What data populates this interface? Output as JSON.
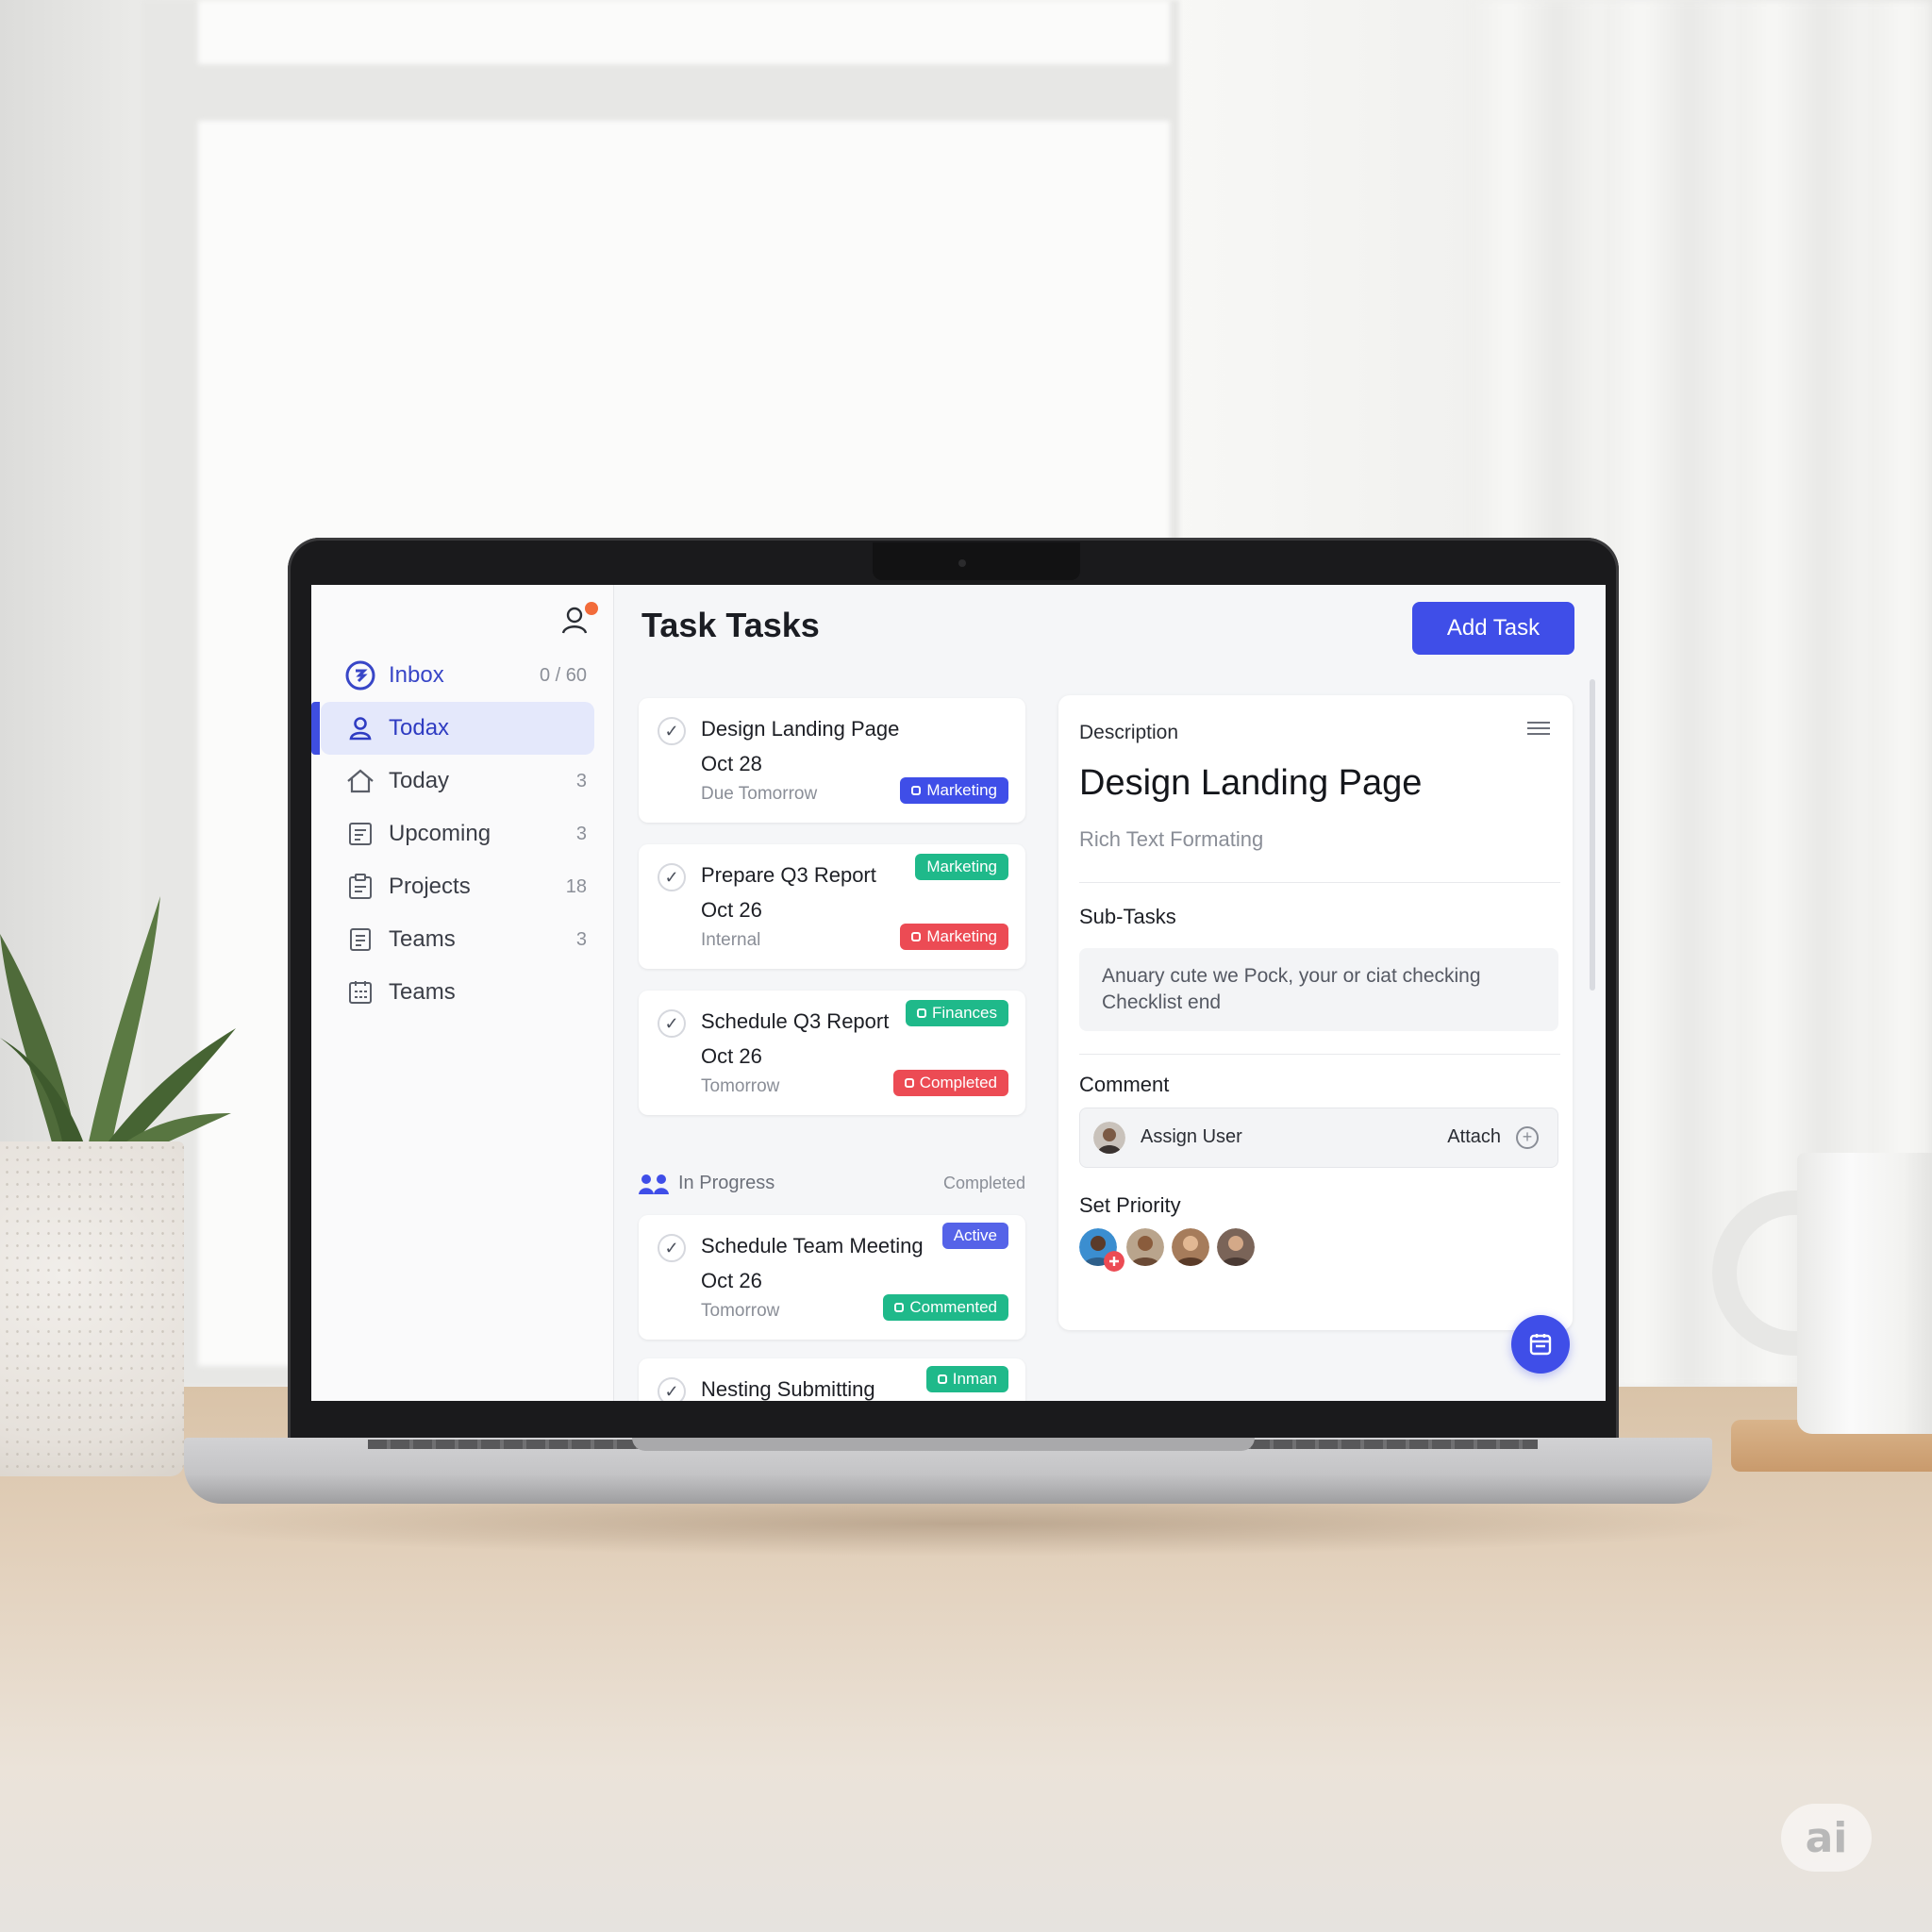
{
  "window": {
    "app_title": "Task Tasks",
    "add_task_label": "Add Task"
  },
  "sidebar": {
    "items": [
      {
        "label": "Inbox",
        "count": "0 / 60",
        "icon": "inbox-circle-icon",
        "state": "highlight"
      },
      {
        "label": "Todax",
        "count": "",
        "icon": "user-icon",
        "state": "active"
      },
      {
        "label": "Today",
        "count": "3",
        "icon": "home-icon"
      },
      {
        "label": "Upcoming",
        "count": "3",
        "icon": "calendar-note-icon"
      },
      {
        "label": "Projects",
        "count": "18",
        "icon": "clipboard-icon"
      },
      {
        "label": "Teams",
        "count": "3",
        "icon": "document-icon"
      },
      {
        "label": "Teams",
        "count": "",
        "icon": "team-grid-icon"
      }
    ]
  },
  "tasks": [
    {
      "title": "Design Landing Page",
      "date": "Oct 28",
      "subtitle": "Due Tomorrow",
      "tags": [
        {
          "label": "Marketing",
          "color": "#3f4ee8"
        }
      ]
    },
    {
      "title": "Prepare Q3 Report",
      "date": "Oct 26",
      "subtitle": "Internal",
      "tags": [
        {
          "label": "Marketing",
          "color": "#1fb98a"
        },
        {
          "label": "Marketing",
          "color": "#ec4b54"
        }
      ]
    },
    {
      "title": "Schedule Q3 Report",
      "date": "Oct 26",
      "subtitle": "Tomorrow",
      "tags": [
        {
          "label": "Finances",
          "color": "#1fb98a"
        },
        {
          "label": "Completed",
          "color": "#ec4b54"
        }
      ]
    }
  ],
  "section": {
    "label": "In Progress",
    "right_label": "Completed"
  },
  "in_progress_tasks": [
    {
      "title": "Schedule Team Meeting",
      "date": "Oct 26",
      "subtitle": "Tomorrow",
      "tags": [
        {
          "label": "Active",
          "color": "#5563e8"
        },
        {
          "label": "Commented",
          "color": "#1fb98a"
        }
      ]
    },
    {
      "title": "Nesting Submitting",
      "tags": [
        {
          "label": "Inman",
          "color": "#1fb98a"
        }
      ]
    }
  ],
  "detail": {
    "section_label": "Description",
    "title": "Design Landing Page",
    "rich_text_label": "Rich Text Formating",
    "subtasks_label": "Sub-Tasks",
    "subtasks_text": "Anuary cute we Pock, your or ciat checking Checklist end",
    "comment_label": "Comment",
    "assign_user_label": "Assign User",
    "attach_label": "Attach",
    "priority_label": "Set Priority"
  },
  "watermark": "ai",
  "colors": {
    "accent": "#3f4ee8",
    "green": "#1fb98a",
    "red": "#ec4b54",
    "notification": "#f26b3a"
  }
}
